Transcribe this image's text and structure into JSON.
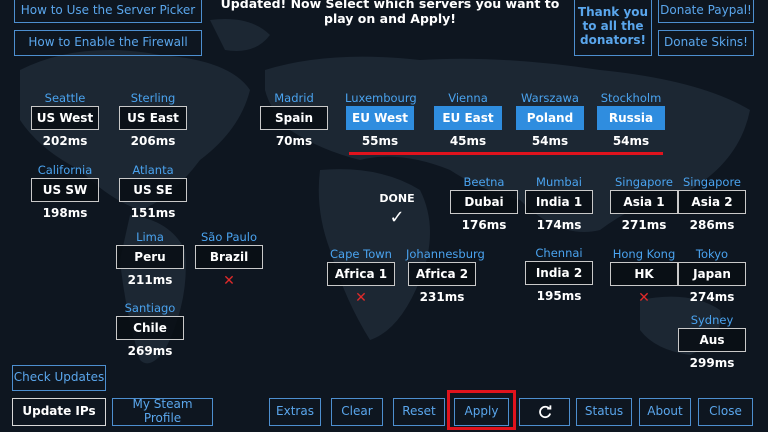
{
  "headline": "Updated! Now Select which servers you want to play on and Apply!",
  "help": {
    "server_picker": "How to Use the Server Picker",
    "firewall": "How to Enable the Firewall"
  },
  "donate": {
    "thanks": "Thank you to all the donators!",
    "paypal": "Donate Paypal!",
    "skins": "Donate Skins!"
  },
  "servers": {
    "seattle": {
      "city": "Seattle",
      "label": "US West",
      "ping": "202ms"
    },
    "sterling": {
      "city": "Sterling",
      "label": "US East",
      "ping": "206ms"
    },
    "california": {
      "city": "California",
      "label": "US SW",
      "ping": "198ms"
    },
    "atlanta": {
      "city": "Atlanta",
      "label": "US SE",
      "ping": "151ms"
    },
    "lima": {
      "city": "Lima",
      "label": "Peru",
      "ping": "211ms"
    },
    "saopaulo": {
      "city": "São Paulo",
      "label": "Brazil",
      "ping": "✕"
    },
    "santiago": {
      "city": "Santiago",
      "label": "Chile",
      "ping": "269ms"
    },
    "madrid": {
      "city": "Madrid",
      "label": "Spain",
      "ping": "70ms"
    },
    "luxembourg": {
      "city": "Luxembourg",
      "label": "EU West",
      "ping": "55ms"
    },
    "vienna": {
      "city": "Vienna",
      "label": "EU East",
      "ping": "45ms"
    },
    "warszawa": {
      "city": "Warszawa",
      "label": "Poland",
      "ping": "54ms"
    },
    "stockholm": {
      "city": "Stockholm",
      "label": "Russia",
      "ping": "54ms"
    },
    "beetna": {
      "city": "Beetna",
      "label": "Dubai",
      "ping": "176ms"
    },
    "mumbai": {
      "city": "Mumbai",
      "label": "India 1",
      "ping": "174ms"
    },
    "chennai": {
      "city": "Chennai",
      "label": "India 2",
      "ping": "195ms"
    },
    "singapore1": {
      "city": "Singapore",
      "label": "Asia 1",
      "ping": "271ms"
    },
    "singapore2": {
      "city": "Singapore",
      "label": "Asia 2",
      "ping": "286ms"
    },
    "hongkong": {
      "city": "Hong Kong",
      "label": "HK",
      "ping": "✕"
    },
    "tokyo": {
      "city": "Tokyo",
      "label": "Japan",
      "ping": "274ms"
    },
    "sydney": {
      "city": "Sydney",
      "label": "Aus",
      "ping": "299ms"
    },
    "capetown": {
      "city": "Cape Town",
      "label": "Africa 1",
      "ping": "✕"
    },
    "johannesburg": {
      "city": "Johannesburg",
      "label": "Africa 2",
      "ping": "231ms"
    }
  },
  "status": {
    "done": "DONE",
    "check": "✓"
  },
  "bottom": {
    "check_updates": "Check Updates",
    "update_ips": "Update IPs",
    "steam_profile": "My Steam Profile",
    "extras": "Extras",
    "clear": "Clear",
    "reset": "Reset",
    "apply": "Apply",
    "status": "Status",
    "about": "About",
    "close": "Close"
  },
  "icons": {
    "refresh": "refresh-icon"
  },
  "colors": {
    "accent": "#2f8ddf",
    "city": "#4aa3ef",
    "highlight": "#e0131d",
    "error": "#e02a2a"
  }
}
